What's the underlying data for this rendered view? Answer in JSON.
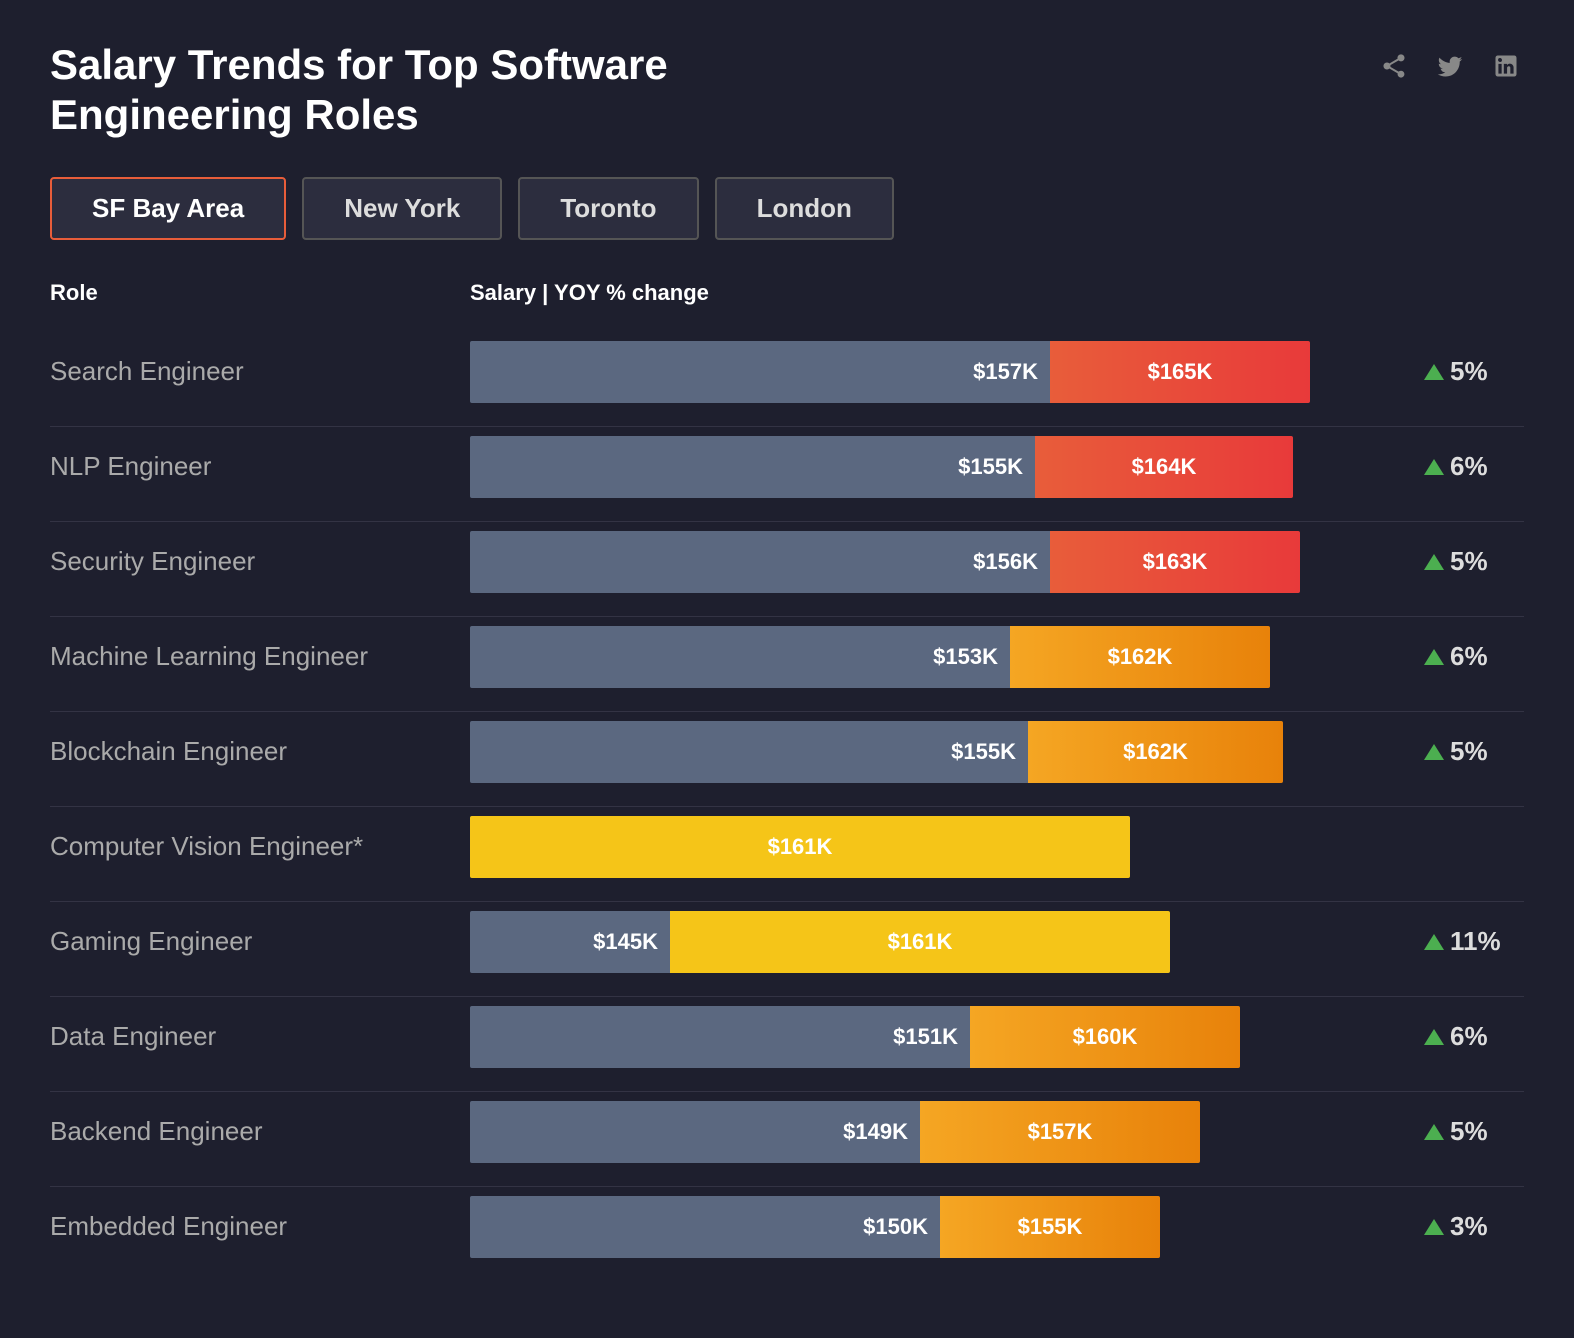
{
  "title": "Salary Trends for Top Software Engineering Roles",
  "social": {
    "share_label": "share",
    "twitter_label": "twitter",
    "linkedin_label": "linkedin"
  },
  "locations": [
    {
      "id": "sf",
      "label": "SF Bay Area",
      "active": true
    },
    {
      "id": "ny",
      "label": "New York",
      "active": false
    },
    {
      "id": "toronto",
      "label": "Toronto",
      "active": false
    },
    {
      "id": "london",
      "label": "London",
      "active": false
    }
  ],
  "table_headers": {
    "role": "Role",
    "salary": "Salary | YOY % change"
  },
  "rows": [
    {
      "role": "Search Engineer",
      "prev_salary": "$157K",
      "curr_salary": "$165K",
      "yoy": "5%",
      "prev_width": 580,
      "curr_width": 260,
      "type": "red"
    },
    {
      "role": "NLP Engineer",
      "prev_salary": "$155K",
      "curr_salary": "$164K",
      "yoy": "6%",
      "prev_width": 565,
      "curr_width": 258,
      "type": "red"
    },
    {
      "role": "Security Engineer",
      "prev_salary": "$156K",
      "curr_salary": "$163K",
      "yoy": "5%",
      "prev_width": 580,
      "curr_width": 250,
      "type": "red"
    },
    {
      "role": "Machine Learning Engineer",
      "prev_salary": "$153K",
      "curr_salary": "$162K",
      "yoy": "6%",
      "prev_width": 540,
      "curr_width": 260,
      "type": "orange"
    },
    {
      "role": "Blockchain Engineer",
      "prev_salary": "$155K",
      "curr_salary": "$162K",
      "yoy": "5%",
      "prev_width": 558,
      "curr_width": 255,
      "type": "orange"
    },
    {
      "role": "Computer Vision Engineer*",
      "prev_salary": null,
      "curr_salary": "$161K",
      "yoy": null,
      "single_width": 660,
      "type": "single-yellow"
    },
    {
      "role": "Gaming Engineer",
      "prev_salary": "$145K",
      "curr_salary": "$161K",
      "yoy": "11%",
      "prev_width": 200,
      "curr_width": 500,
      "type": "yellow"
    },
    {
      "role": "Data Engineer",
      "prev_salary": "$151K",
      "curr_salary": "$160K",
      "yoy": "6%",
      "prev_width": 500,
      "curr_width": 270,
      "type": "orange"
    },
    {
      "role": "Backend Engineer",
      "prev_salary": "$149K",
      "curr_salary": "$157K",
      "yoy": "5%",
      "prev_width": 450,
      "curr_width": 280,
      "type": "orange"
    },
    {
      "role": "Embedded Engineer",
      "prev_salary": "$150K",
      "curr_salary": "$155K",
      "yoy": "3%",
      "prev_width": 470,
      "curr_width": 220,
      "type": "orange"
    }
  ]
}
